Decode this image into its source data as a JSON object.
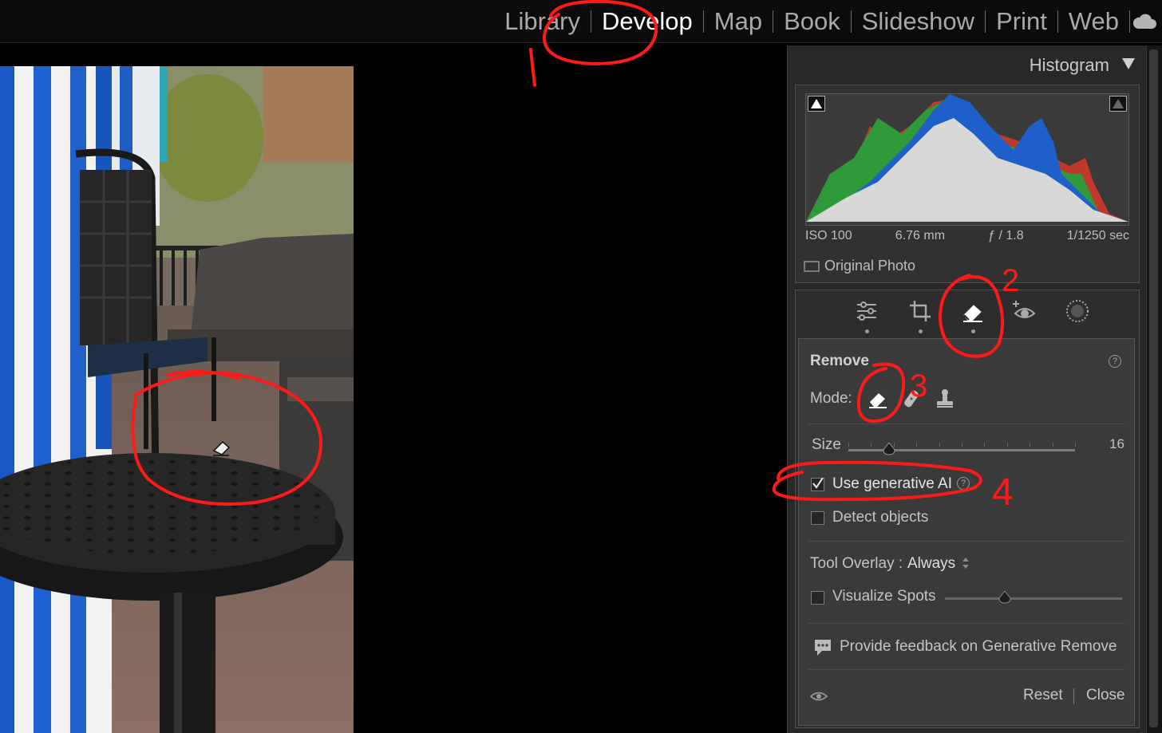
{
  "modules": [
    {
      "label": "Library",
      "active": false
    },
    {
      "label": "Develop",
      "active": true
    },
    {
      "label": "Map",
      "active": false
    },
    {
      "label": "Book",
      "active": false
    },
    {
      "label": "Slideshow",
      "active": false
    },
    {
      "label": "Print",
      "active": false
    },
    {
      "label": "Web",
      "active": false
    }
  ],
  "cloud_icon": "cloud-icon",
  "histogram": {
    "title": "Histogram",
    "iso": "ISO 100",
    "focal": "6.76 mm",
    "aperture": "ƒ / 1.8",
    "shutter": "1/1250 sec",
    "original_photo": "Original Photo"
  },
  "tools": [
    "edit-sliders-icon",
    "crop-icon",
    "remove-eraser-icon",
    "red-eye-icon",
    "masking-icon"
  ],
  "remove": {
    "title": "Remove",
    "mode_label": "Mode:",
    "modes": [
      "remove-icon",
      "heal-icon",
      "clone-icon"
    ],
    "size_label": "Size",
    "size_value": "16",
    "size_level": 0.18,
    "use_gen_ai": "Use generative AI",
    "use_gen_ai_checked": true,
    "detect_objects": "Detect objects",
    "detect_objects_checked": false,
    "tool_overlay_label": "Tool Overlay :",
    "tool_overlay_value": "Always",
    "visualize_spots": "Visualize Spots",
    "visualize_level": 0.34,
    "feedback": "Provide feedback on Generative Remove",
    "reset": "Reset",
    "close": "Close"
  },
  "annotations": [
    "1",
    "2",
    "3",
    "4"
  ],
  "colors": {
    "annotation": "#ff1a1a",
    "panel": "#282828",
    "subpanel": "#3a3a3a"
  }
}
